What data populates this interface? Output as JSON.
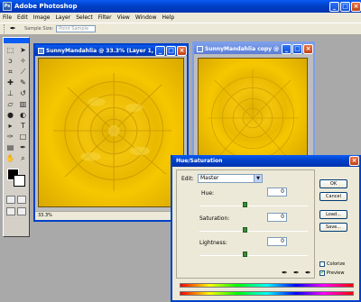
{
  "app": {
    "title": "Adobe Photoshop",
    "icon": "Ps"
  },
  "menu": [
    "File",
    "Edit",
    "Image",
    "Layer",
    "Select",
    "Filter",
    "View",
    "Window",
    "Help"
  ],
  "options_bar": {
    "sample_size_label": "Sample Size:",
    "sample_size_value": "Point Sample"
  },
  "documents": [
    {
      "title": "SunnyMandahlia @ 33.3% (Layer 1, R...",
      "zoom": "33.3%"
    },
    {
      "title": "SunnyMandahlia copy @ 25..."
    }
  ],
  "dialog": {
    "title": "Hue/Saturation",
    "edit_label": "Edit:",
    "edit_value": "Master",
    "hue_label": "Hue:",
    "hue_value": "0",
    "saturation_label": "Saturation:",
    "saturation_value": "0",
    "lightness_label": "Lightness:",
    "lightness_value": "0",
    "buttons": {
      "ok": "OK",
      "cancel": "Cancel",
      "load": "Load...",
      "save": "Save..."
    },
    "colorize_label": "Colorize",
    "preview_label": "Preview",
    "colorize_checked": false,
    "preview_checked": true
  },
  "colors": {
    "title_active": "#0041c8",
    "title_inactive": "#7d9ee9",
    "photo_yellow": "#f2c40b"
  },
  "window_controls": {
    "minimize": "_",
    "maximize": "□",
    "close": "×"
  }
}
